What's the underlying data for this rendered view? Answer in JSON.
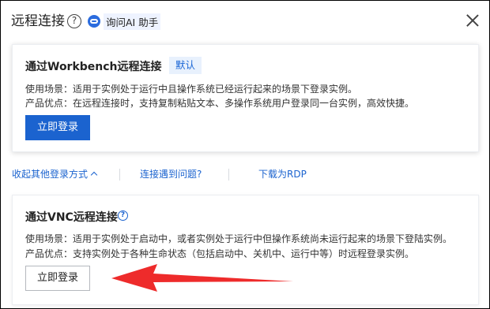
{
  "dialog": {
    "title": "远程连接",
    "help_glyph": "?",
    "ai_label": "询问AI 助手",
    "close_icon": "close-icon"
  },
  "workbench_card": {
    "title": "通过Workbench远程连接",
    "badge": "默认",
    "usage": "使用场景：适用于实例处于运行中且操作系统已经运行起来的场景下登录实例。",
    "advantage": "产品优点：在远程连接时，支持复制粘贴文本、多操作系统用户登录同一台实例，高效快捷。",
    "login_button": "立即登录"
  },
  "links": {
    "collapse_other": "收起其他登录方式",
    "connection_problem": "连接遇到问题?",
    "download_rdp": "下载为RDP"
  },
  "vnc_card": {
    "title": "通过VNC远程连接",
    "help_glyph": "?",
    "usage": "使用场景：适用于实例处于启动中，或者实例处于运行中但操作系统尚未运行起来的场景下登陆实例。",
    "advantage": "产品优点：支持实例处于各种生命状态（包括启动中、关机中、运行中等）时远程登录实例。",
    "login_button": "立即登录"
  },
  "colors": {
    "primary": "#1b63cf",
    "badge_bg": "#e8f1fd",
    "annotation_arrow": "#ee2b2b"
  }
}
